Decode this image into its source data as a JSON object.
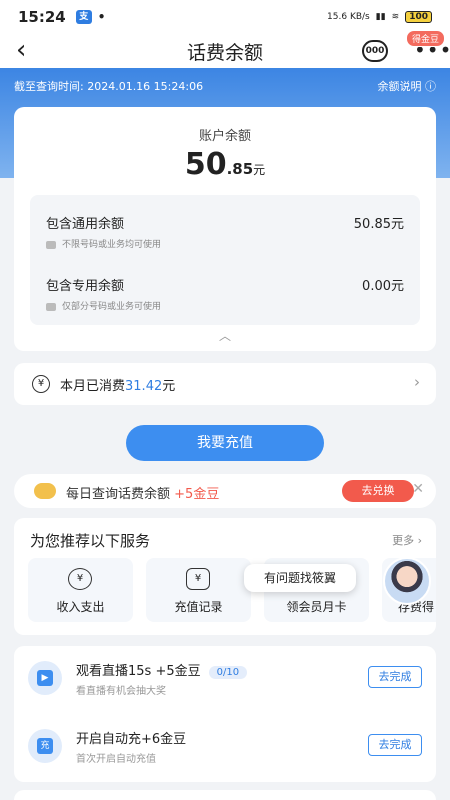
{
  "status_bar": {
    "time": "15:24",
    "app_icon": "alipay-icon",
    "net_speed": "15.6 KB/s",
    "battery": "100"
  },
  "nav": {
    "title": "话费余额",
    "gold_tag": "得金豆",
    "service_icon": "customer-service-icon",
    "more_icon": "more-dots-icon"
  },
  "header": {
    "query_time": "截至查询时间: 2024.01.16 15:24:06",
    "explain": "余额说明 ⓘ"
  },
  "balance": {
    "label": "账户余额",
    "amount_int": "50",
    "amount_dec": ".85",
    "unit": "元",
    "general": {
      "name": "包含通用余额",
      "value": "50.85元",
      "note": "不限号码或业务均可使用"
    },
    "special": {
      "name": "包含专用余额",
      "value": "0.00元",
      "note": "仅部分号码或业务可使用"
    }
  },
  "monthly": {
    "prefix": "本月已消费",
    "amount": "31.42",
    "unit": "元"
  },
  "recharge_button": "我要充值",
  "daily_banner": {
    "text": "每日查询话费余额",
    "bonus": "+5金豆",
    "button": "去兑换"
  },
  "recommend": {
    "title": "为您推荐以下服务",
    "more": "更多 ›",
    "items": [
      {
        "label": "收入支出",
        "icon": "¥"
      },
      {
        "label": "充值记录",
        "icon": "¥"
      },
      {
        "label": "领会员月卡",
        "icon": ""
      },
      {
        "label": "存费得",
        "icon": ""
      }
    ],
    "tooltip": "有问题找筱翼"
  },
  "tasks": [
    {
      "title": "观看直播15s +5金豆",
      "progress": "0/10",
      "desc": "看直播有机会抽大奖",
      "button": "去完成",
      "icon": "▶"
    },
    {
      "title": "开启自动充+6金豆",
      "progress": "",
      "desc": "首次开启自动充值",
      "button": "去完成",
      "icon": "充"
    }
  ]
}
